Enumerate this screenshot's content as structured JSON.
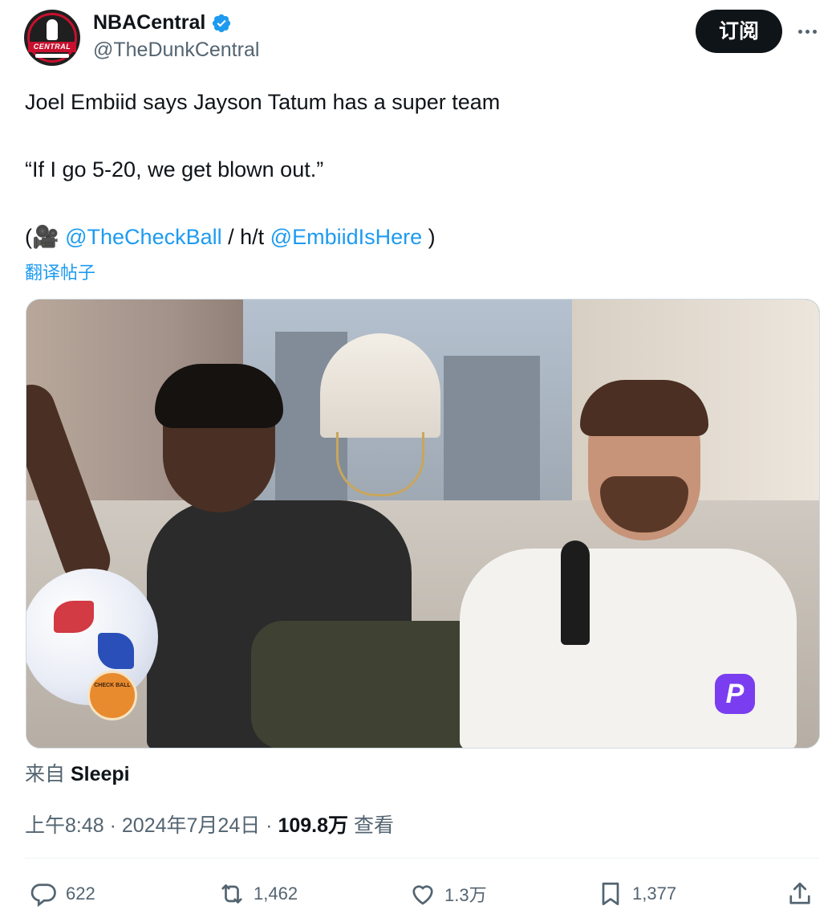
{
  "header": {
    "display_name": "NBACentral",
    "handle": "@TheDunkCentral",
    "subscribe_label": "订阅",
    "avatar_banner": "CENTRAL"
  },
  "tweet": {
    "line1": "Joel Embiid says Jayson Tatum has a super team",
    "line2": "“If I go 5-20, we get blown out.”",
    "line3_open": "(🎥 ",
    "mention1": "@TheCheckBall",
    "line3_mid": " / h/t ",
    "mention2": "@EmbiidIsHere",
    "line3_close": " )",
    "translate": "翻译帖子"
  },
  "media": {
    "watermark_badge": "CHECK BALL",
    "corner_logo": "P"
  },
  "source": {
    "prefix": "来自",
    "name": "Sleepi"
  },
  "meta": {
    "time": "上午8:48",
    "date": "2024年7月24日",
    "views": "109.8万",
    "views_label": "查看"
  },
  "actions": {
    "reply_count": "622",
    "retweet_count": "1,462",
    "like_count": "1.3万",
    "bookmark_count": "1,377"
  },
  "colors": {
    "accent": "#1d9bf0",
    "text": "#0f1419",
    "secondary": "#536471",
    "button_bg": "#0f1419"
  }
}
